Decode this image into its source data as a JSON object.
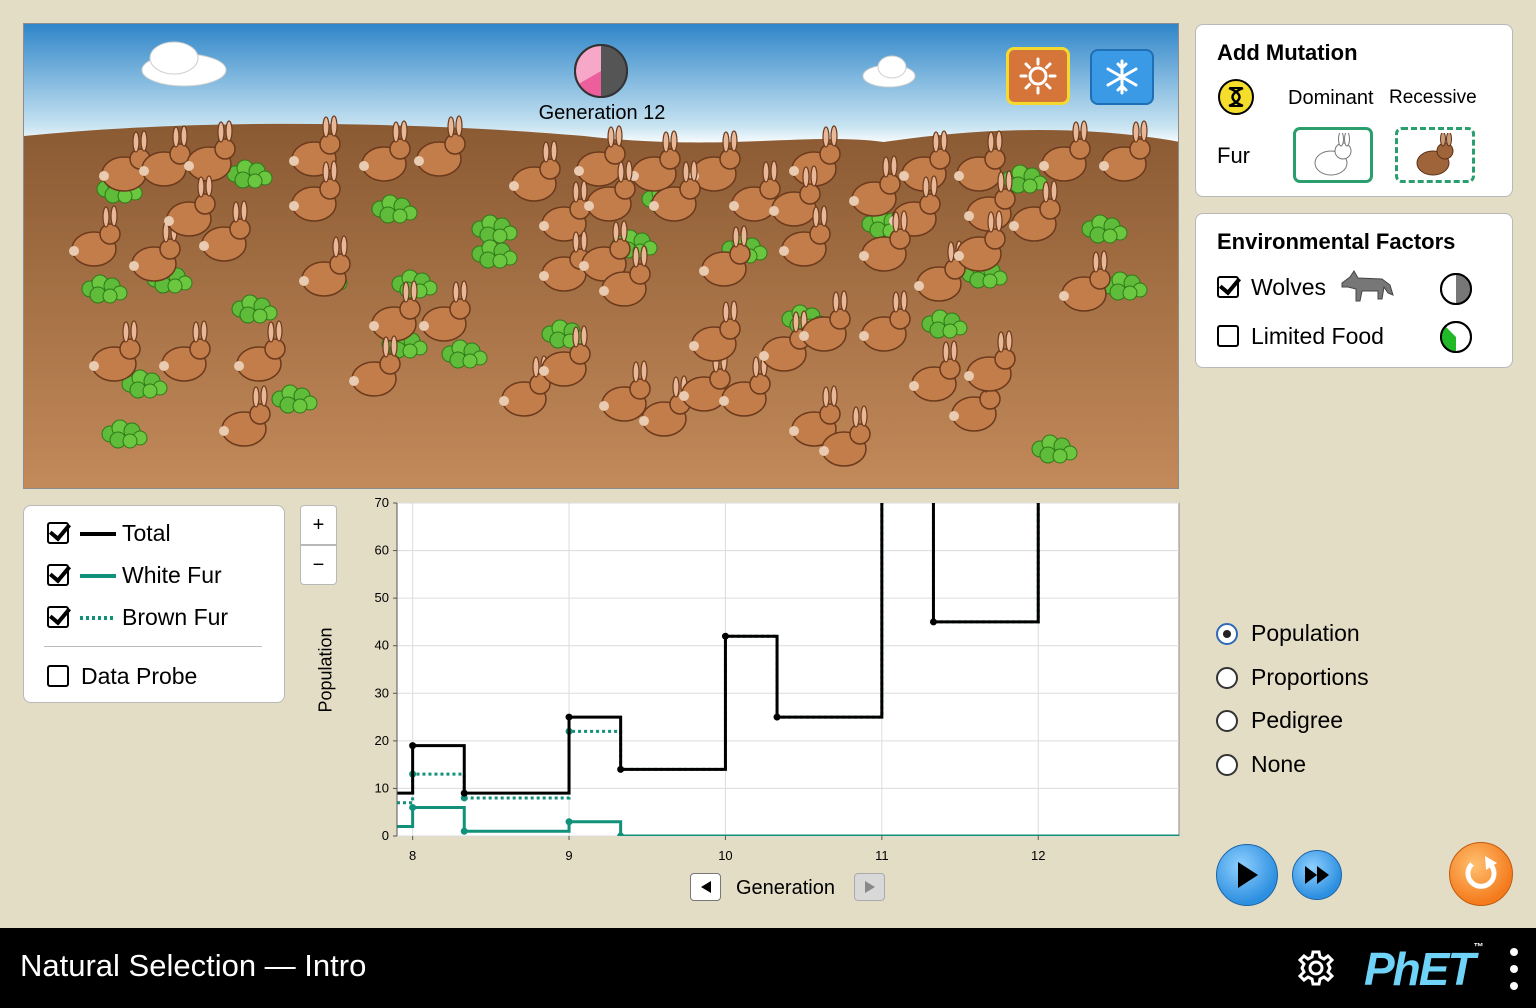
{
  "scene": {
    "generation_label": "Generation 12",
    "environment_buttons": {
      "equator_icon": "sun-icon",
      "arctic_icon": "snowflake-icon",
      "selected": "equator"
    },
    "bunnies_fur": "brown"
  },
  "mutation_panel": {
    "title": "Add Mutation",
    "dominant_label": "Dominant",
    "recessive_label": "Recessive",
    "trait_label": "Fur",
    "icons": {
      "dna": "dna-icon",
      "dominant": "white-bunny-icon",
      "recessive": "brown-bunny-icon"
    }
  },
  "environment_panel": {
    "title": "Environmental Factors",
    "factors": [
      {
        "label": "Wolves",
        "checked": true,
        "icon": "wolf-icon",
        "clock": "wolf-clock-icon"
      },
      {
        "label": "Limited Food",
        "checked": false,
        "clock": "food-clock-icon"
      }
    ]
  },
  "legend": {
    "items": [
      {
        "label": "Total",
        "checked": true,
        "color": "#000000",
        "style": "solid"
      },
      {
        "label": "White Fur",
        "checked": true,
        "color": "#11907a",
        "style": "solid"
      },
      {
        "label": "Brown Fur",
        "checked": true,
        "color": "#11907a",
        "style": "dotted"
      }
    ],
    "data_probe": {
      "label": "Data Probe",
      "checked": false
    }
  },
  "graph": {
    "zoom_in": "+",
    "zoom_out": "−",
    "ylabel": "Population",
    "xlabel": "Generation"
  },
  "graph_view_options": [
    {
      "label": "Population",
      "selected": true
    },
    {
      "label": "Proportions",
      "selected": false
    },
    {
      "label": "Pedigree",
      "selected": false
    },
    {
      "label": "None",
      "selected": false
    }
  ],
  "controls": {
    "play": "play-icon",
    "step_forward": "fast-forward-icon",
    "reset": "reset-icon"
  },
  "navbar": {
    "title": "Natural Selection — Intro",
    "logo": "PhET",
    "logo_tm": "™"
  },
  "colors": {
    "background": "#e3ddc6",
    "white_fur": "#11907a",
    "total": "#000000",
    "button_blue": "#2d8fe0",
    "reset_orange": "#f47b1d"
  },
  "chart_data": {
    "type": "line",
    "xlabel": "Generation",
    "ylabel": "Population",
    "xlim": [
      7.9,
      12.9
    ],
    "ylim": [
      0,
      70
    ],
    "xticks": [
      8,
      9,
      10,
      11,
      12
    ],
    "yticks": [
      0,
      10,
      20,
      30,
      40,
      50,
      60,
      70
    ],
    "grid": true,
    "series": [
      {
        "name": "Total",
        "style": "solid",
        "color": "#000000",
        "points": [
          [
            7.9,
            9
          ],
          [
            8,
            9
          ],
          [
            8,
            19
          ],
          [
            8.33,
            19
          ],
          [
            8.33,
            9
          ],
          [
            9,
            9
          ],
          [
            9,
            25
          ],
          [
            9.33,
            25
          ],
          [
            9.33,
            14
          ],
          [
            10,
            14
          ],
          [
            10,
            42
          ],
          [
            10.33,
            42
          ],
          [
            10.33,
            25
          ],
          [
            11,
            25
          ],
          [
            11,
            72
          ],
          [
            11.33,
            72
          ],
          [
            11.33,
            45
          ],
          [
            12,
            45
          ],
          [
            12,
            72
          ]
        ],
        "markers": [
          [
            8,
            19
          ],
          [
            8.33,
            9
          ],
          [
            9,
            25
          ],
          [
            9.33,
            14
          ],
          [
            10,
            42
          ],
          [
            10.33,
            25
          ],
          [
            11.33,
            45
          ]
        ]
      },
      {
        "name": "White Fur",
        "style": "solid",
        "color": "#11907a",
        "points": [
          [
            7.9,
            2
          ],
          [
            8,
            2
          ],
          [
            8,
            6
          ],
          [
            8.33,
            6
          ],
          [
            8.33,
            1
          ],
          [
            9,
            1
          ],
          [
            9,
            3
          ],
          [
            9.33,
            3
          ],
          [
            9.33,
            0
          ],
          [
            12.9,
            0
          ]
        ],
        "markers": [
          [
            8,
            6
          ],
          [
            8.33,
            1
          ],
          [
            9,
            3
          ],
          [
            9.33,
            0
          ]
        ]
      },
      {
        "name": "Brown Fur",
        "style": "dotted",
        "color": "#11907a",
        "points": [
          [
            7.9,
            7
          ],
          [
            8,
            7
          ],
          [
            8,
            13
          ],
          [
            8.33,
            13
          ],
          [
            8.33,
            8
          ],
          [
            9,
            8
          ],
          [
            9,
            22
          ],
          [
            9.33,
            22
          ],
          [
            9.33,
            14
          ],
          [
            10,
            14
          ],
          [
            10,
            42
          ],
          [
            10.33,
            42
          ],
          [
            10.33,
            25
          ],
          [
            11,
            25
          ],
          [
            11,
            72
          ],
          [
            11.33,
            72
          ],
          [
            11.33,
            45
          ],
          [
            12,
            45
          ],
          [
            12,
            72
          ]
        ],
        "markers": [
          [
            8,
            13
          ],
          [
            8.33,
            8
          ],
          [
            9,
            22
          ]
        ]
      }
    ]
  }
}
